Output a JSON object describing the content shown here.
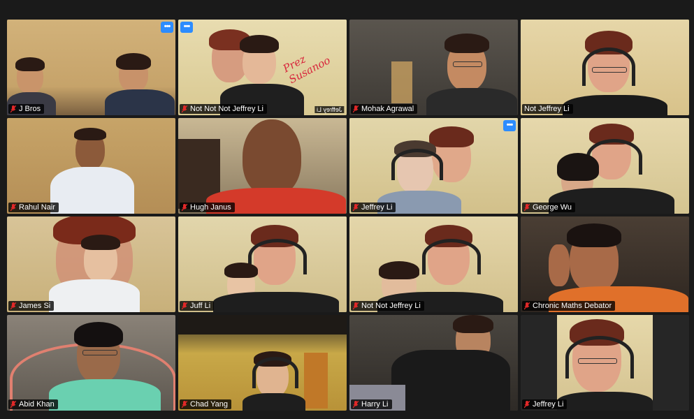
{
  "participants": [
    {
      "name": "J Bros",
      "muted": true,
      "active": false,
      "more_menu": true
    },
    {
      "name": "Not Not Not Jeffrey Li",
      "muted": true,
      "active": true,
      "more_menu": true,
      "more_left": true,
      "overlay_text": "Prez Susanoo",
      "mirror_tag": "Jeffrey Li"
    },
    {
      "name": "Mohak Agrawal",
      "muted": true,
      "active": false
    },
    {
      "name": "Not Jeffrey Li",
      "muted": false,
      "active": true
    },
    {
      "name": "Rahul Nair",
      "muted": true,
      "active": false
    },
    {
      "name": "Hugh Janus",
      "muted": true,
      "active": false
    },
    {
      "name": "Jeffrey Li",
      "muted": true,
      "active": true,
      "more_menu": true
    },
    {
      "name": "George Wu",
      "muted": true,
      "active": false
    },
    {
      "name": "James Si",
      "muted": true,
      "active": false
    },
    {
      "name": "Juff Li",
      "muted": true,
      "active": true
    },
    {
      "name": "Not Not Jeffrey Li",
      "muted": true,
      "active": true
    },
    {
      "name": "Chronic Maths Debator",
      "muted": true,
      "active": false
    },
    {
      "name": "Abid Khan",
      "muted": true,
      "active": false
    },
    {
      "name": "Chad Yang",
      "muted": true,
      "active": false
    },
    {
      "name": "Harry Li",
      "muted": true,
      "active": false
    },
    {
      "name": "Jeffrey Li",
      "muted": true,
      "active": false
    }
  ],
  "icons": {
    "muted": "mic-muted-icon",
    "more": "more-options-icon"
  },
  "colors": {
    "active_border": "#cfe04a",
    "more_button": "#2d8cff",
    "muted_mic": "#e02828",
    "background": "#1a1a1a"
  }
}
